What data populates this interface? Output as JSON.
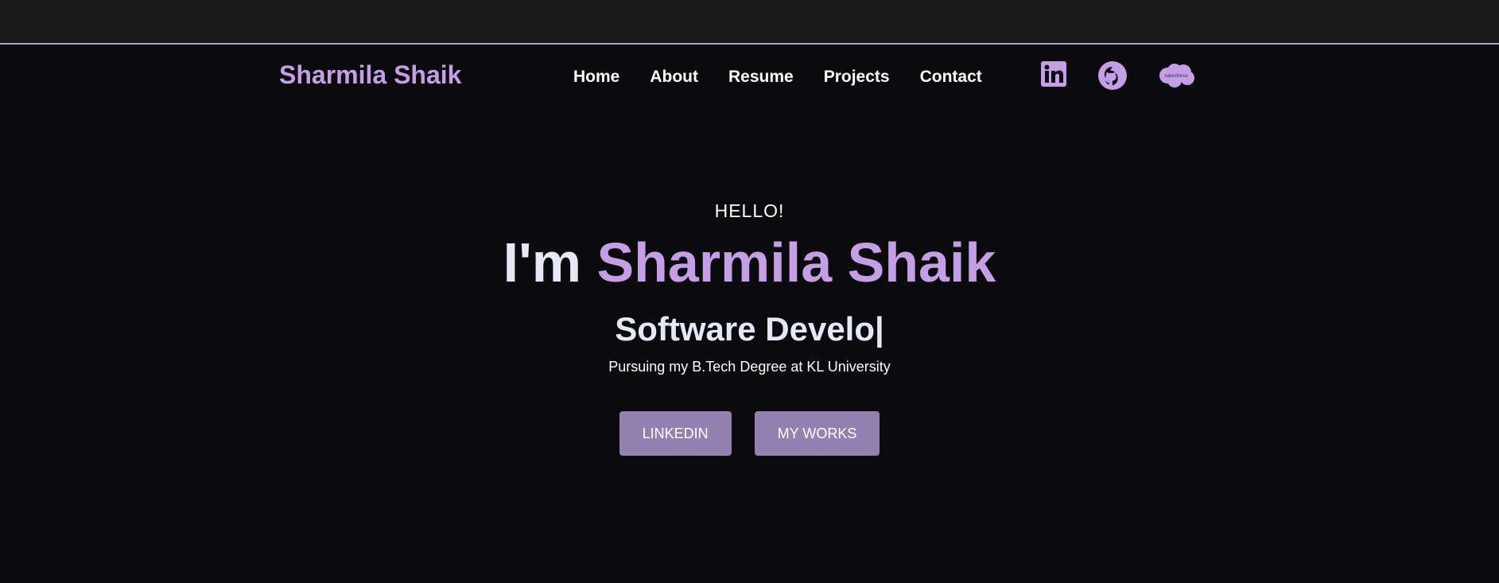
{
  "header": {
    "brand": "Sharmila Shaik",
    "nav": [
      {
        "label": "Home"
      },
      {
        "label": "About"
      },
      {
        "label": "Resume"
      },
      {
        "label": "Projects"
      },
      {
        "label": "Contact"
      }
    ],
    "social": [
      {
        "icon": "linkedin-icon"
      },
      {
        "icon": "github-icon"
      },
      {
        "icon": "salesforce-icon",
        "text": "salesforce"
      }
    ]
  },
  "hero": {
    "greeting": "HELLO!",
    "headline_prefix": "I'm ",
    "headline_name": "Sharmila Shaik",
    "role_typed": "Software Develo|",
    "subtitle": "Pursuing my B.Tech Degree at KL University",
    "buttons": [
      {
        "label": "LINKEDIN"
      },
      {
        "label": "MY WORKS"
      }
    ]
  },
  "colors": {
    "background": "#0b0b0e",
    "topbar": "#1a1a1b",
    "accent": "#c49fe6",
    "button": "#9480b1",
    "text": "#ffffff"
  }
}
